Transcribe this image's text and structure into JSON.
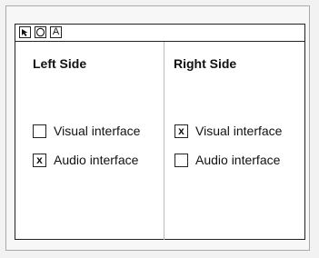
{
  "toolbar": {
    "tools": [
      {
        "name": "pointer-tool",
        "glyph": "↖"
      },
      {
        "name": "circle-tool",
        "glyph": "○"
      },
      {
        "name": "text-tool",
        "glyph": "A"
      }
    ]
  },
  "left": {
    "title": "Left Side",
    "options": [
      {
        "label": "Visual interface",
        "checked": false,
        "mark": ""
      },
      {
        "label": "Audio interface",
        "checked": true,
        "mark": "x"
      }
    ]
  },
  "right": {
    "title": "Right Side",
    "options": [
      {
        "label": "Visual interface",
        "checked": true,
        "mark": "x"
      },
      {
        "label": "Audio interface",
        "checked": false,
        "mark": ""
      }
    ]
  }
}
